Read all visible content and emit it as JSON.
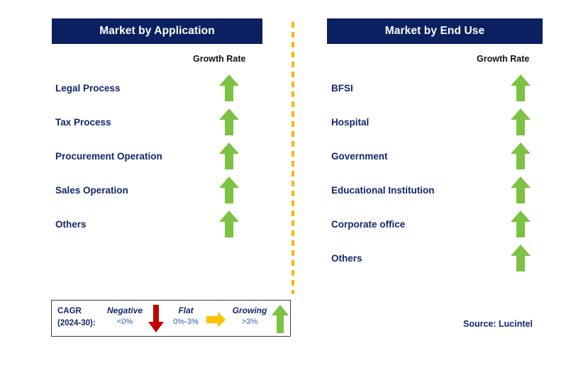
{
  "theme": {
    "header_bg": "#0a2060",
    "header_text": "#ffffff",
    "label_color": "#11266e",
    "arrow_growing": "#7dc242",
    "arrow_negative": "#c00000",
    "arrow_flat": "#ffc000",
    "divider_color": "#ffb400"
  },
  "panels": [
    {
      "id": "application",
      "title": "Market by Application",
      "column_header": "Growth Rate",
      "rows": [
        {
          "label": "Legal Process",
          "growth": "growing",
          "icon": "up-arrow-icon"
        },
        {
          "label": "Tax Process",
          "growth": "growing",
          "icon": "up-arrow-icon"
        },
        {
          "label": "Procurement Operation",
          "growth": "growing",
          "icon": "up-arrow-icon"
        },
        {
          "label": "Sales Operation",
          "growth": "growing",
          "icon": "up-arrow-icon"
        },
        {
          "label": "Others",
          "growth": "growing",
          "icon": "up-arrow-icon"
        }
      ]
    },
    {
      "id": "enduse",
      "title": "Market by End Use",
      "column_header": "Growth Rate",
      "rows": [
        {
          "label": "BFSI",
          "growth": "growing",
          "icon": "up-arrow-icon"
        },
        {
          "label": "Hospital",
          "growth": "growing",
          "icon": "up-arrow-icon"
        },
        {
          "label": "Government",
          "growth": "growing",
          "icon": "up-arrow-icon"
        },
        {
          "label": "Educational Institution",
          "growth": "growing",
          "icon": "up-arrow-icon"
        },
        {
          "label": "Corporate office",
          "growth": "growing",
          "icon": "up-arrow-icon"
        },
        {
          "label": "Others",
          "growth": "growing",
          "icon": "up-arrow-icon"
        }
      ]
    }
  ],
  "legend": {
    "title_line1": "CAGR",
    "title_line2": "(2024-30):",
    "items": [
      {
        "term": "Negative",
        "range": "<0%",
        "icon": "down-arrow-icon",
        "color": "#c00000"
      },
      {
        "term": "Flat",
        "range": "0%-3%",
        "icon": "right-arrow-icon",
        "color": "#ffc000"
      },
      {
        "term": "Growing",
        "range": ">3%",
        "icon": "up-arrow-icon",
        "color": "#7dc242"
      }
    ]
  },
  "source": "Source: Lucintel"
}
